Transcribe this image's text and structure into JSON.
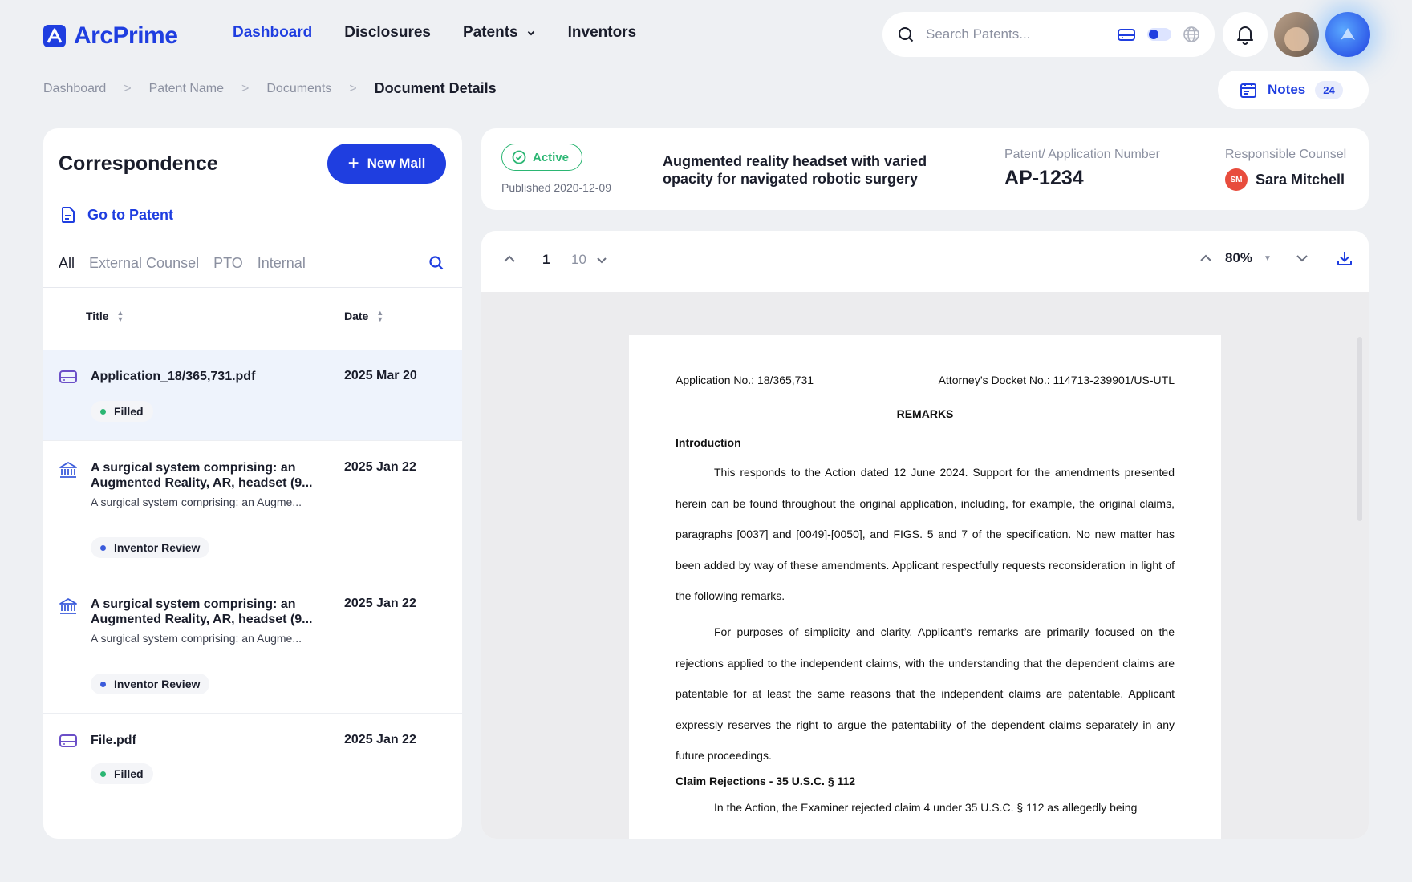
{
  "app": {
    "name": "ArcPrime"
  },
  "nav": [
    {
      "label": "Dashboard",
      "active": true
    },
    {
      "label": "Disclosures",
      "active": false
    },
    {
      "label": "Patents",
      "active": false,
      "dropdown": true
    },
    {
      "label": "Inventors",
      "active": false
    }
  ],
  "search": {
    "placeholder": "Search Patents..."
  },
  "breadcrumb": [
    "Dashboard",
    "Patent Name",
    "Documents",
    "Document Details"
  ],
  "notes": {
    "label": "Notes",
    "count": "24"
  },
  "correspondence": {
    "title": "Correspondence",
    "new_mail_label": "New Mail",
    "goto_label": "Go to Patent",
    "filters": [
      "All",
      "External Counsel",
      "PTO",
      "Internal"
    ],
    "columns": {
      "title": "Title",
      "date": "Date"
    },
    "items": [
      {
        "icon": "drive-icon",
        "title": "Application_18/365,731.pdf",
        "subtitle": "",
        "date": "2025 Mar 20",
        "status": "Filled",
        "status_color": "#2bb673",
        "selected": true
      },
      {
        "icon": "bank-icon",
        "title": "A surgical system comprising: an Augmented Reality, AR, headset (9...",
        "subtitle": "A surgical system comprising: an Augme...",
        "date": "2025 Jan 22",
        "status": "Inventor Review",
        "status_color": "#3b5bdb",
        "selected": false
      },
      {
        "icon": "bank-icon",
        "title": "A surgical system comprising: an Augmented Reality, AR, headset (9...",
        "subtitle": "A surgical system comprising: an Augme...",
        "date": "2025 Jan 22",
        "status": "Inventor Review",
        "status_color": "#3b5bdb",
        "selected": false
      },
      {
        "icon": "drive-icon",
        "title": "File.pdf",
        "subtitle": "",
        "date": "2025 Jan 22",
        "status": "Filled",
        "status_color": "#2bb673",
        "selected": false
      }
    ]
  },
  "patent": {
    "status": "Active",
    "published": "Published 2020-12-09",
    "title": "Augmented reality headset with varied opacity for navigated robotic surgery",
    "number_label": "Patent/ Application Number",
    "number": "AP-1234",
    "counsel_label": "Responsible Counsel",
    "counsel_initials": "SM",
    "counsel_name": "Sara Mitchell"
  },
  "viewer": {
    "page": "1",
    "total_pages": "10",
    "zoom": "80%"
  },
  "document": {
    "application_no": "Application No.:  18/365,731",
    "docket_no": "Attorney’s Docket No.: 114713-239901/US-UTL",
    "heading": "REMARKS",
    "section1": "Introduction",
    "para1": "This responds to the Action dated 12 June 2024. Support for the amendments presented herein can be found throughout the original application, including, for example, the original claims, paragraphs [0037] and [0049]-[0050], and FIGS. 5 and 7 of the specification. No new matter has been added by way of these amendments. Applicant respectfully requests reconsideration in light of the following remarks.",
    "para2": "For purposes of simplicity and clarity, Applicant’s remarks are primarily focused on the rejections applied to the independent claims, with the understanding that the dependent claims are patentable for at least the same reasons that the independent claims are patentable. Applicant expressly reserves the right to argue the patentability of the dependent claims separately in any future proceedings.",
    "section2": "Claim Rejections - 35 U.S.C. § 112",
    "para3": "In the Action, the Examiner rejected claim 4 under 35 U.S.C. § 112 as allegedly being"
  },
  "colors": {
    "accent": "#1f3ee0",
    "success": "#2bb673",
    "review": "#3b5bdb",
    "counsel_avatar": "#e84c3d"
  }
}
